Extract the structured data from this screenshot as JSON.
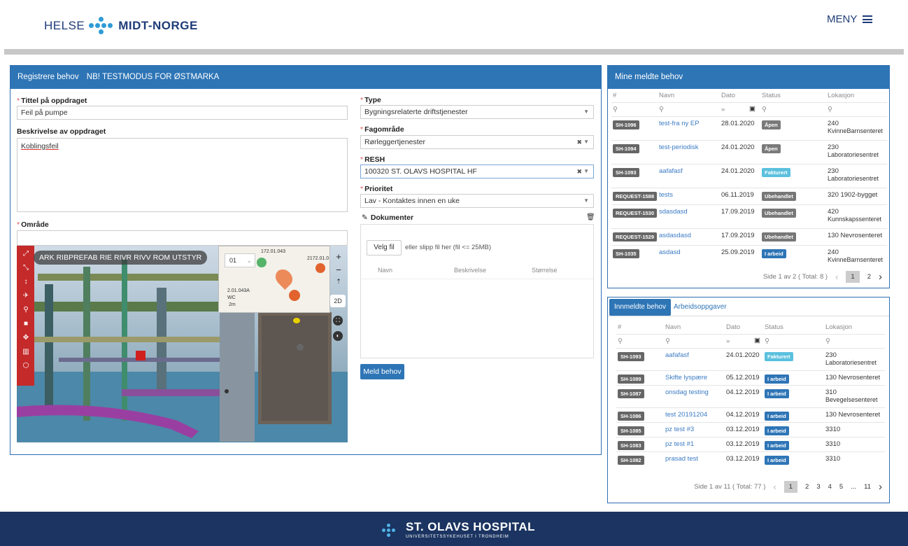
{
  "header": {
    "brand_left": "HELSE",
    "brand_right": "MIDT-NORGE",
    "menu_label": "MENY"
  },
  "form": {
    "title": "Registrere behov",
    "subtitle": "NB! TESTMODUS FOR ØSTMARKA",
    "tittel_label": "Tittel på oppdraget",
    "tittel_value": "Feil på pumpe",
    "beskrivelse_label": "Beskrivelse av oppdraget",
    "beskrivelse_value": "Koblingsfeil",
    "omrade_label": "Område",
    "type_label": "Type",
    "type_value": "Bygningsrelaterte driftstjenester",
    "fag_label": "Fagområde",
    "fag_value": "Rørleggertjenester",
    "resh_label": "RESH",
    "resh_value": "100320 ST. OLAVS HOSPITAL HF",
    "prioritet_label": "Prioritet",
    "prioritet_value": "Lav - Kontaktes innen en uke",
    "dokumenter_label": "Dokumenter",
    "velg_fil": "Velg fil",
    "drop_hint": "eller slipp fil her (fil <= 25MB)",
    "doc_cols": [
      "Navn",
      "Beskrivelse",
      "Størrelse"
    ],
    "submit": "Meld behov"
  },
  "viewer": {
    "layers": [
      "ARK",
      "RIBPREFAB",
      "RIE",
      "RIVR",
      "RIVV",
      "ROM",
      "UTSTYR"
    ],
    "floor": "01",
    "mode_2d": "2D",
    "plan_labels": [
      "172.01.043",
      "2172.01.0",
      "2.01.043A",
      "WC",
      "2m"
    ]
  },
  "mine": {
    "title": "Mine meldte behov",
    "cols": [
      "#",
      "Navn",
      "Dato",
      "Status",
      "Lokasjon"
    ],
    "rows": [
      {
        "id": "SH-1096",
        "navn": "test-fra ny EP",
        "dato": "28.01.2020",
        "status": "Åpen",
        "lok1": "240",
        "lok2": "KvinneBarnsenteret"
      },
      {
        "id": "SH-1094",
        "navn": "test-periodisk",
        "dato": "24.01.2020",
        "status": "Åpen",
        "lok1": "230",
        "lok2": "Laboratoriesentret"
      },
      {
        "id": "SH-1093",
        "navn": "aafafasf",
        "dato": "24.01.2020",
        "status": "Fakturert",
        "lok1": "230",
        "lok2": "Laboratoriesentret"
      },
      {
        "id": "REQUEST-1588",
        "navn": "tests",
        "dato": "06.11.2019",
        "status": "Ubehandlet",
        "lok1": "320 1902-bygget",
        "lok2": ""
      },
      {
        "id": "REQUEST-1530",
        "navn": "sdasdasd",
        "dato": "17.09.2019",
        "status": "Ubehandlet",
        "lok1": "420",
        "lok2": "Kunnskapssenteret"
      },
      {
        "id": "REQUEST-1529",
        "navn": "asdasdasd",
        "dato": "17.09.2019",
        "status": "Ubehandlet",
        "lok1": "130 Nevrosenteret",
        "lok2": ""
      },
      {
        "id": "SH-1035",
        "navn": "asdasd",
        "dato": "25.09.2019",
        "status": "I arbeid",
        "lok1": "240",
        "lok2": "KvinneBarnsenteret"
      }
    ],
    "pager_text": "Side 1 av 2 ( Total: 8 )",
    "pages": [
      "1",
      "2"
    ]
  },
  "innmeldte": {
    "tab_active": "Innmeldte behov",
    "tab_other": "Arbeidsoppgaver",
    "cols": [
      "#",
      "Navn",
      "Dato",
      "Status",
      "Lokasjon"
    ],
    "rows": [
      {
        "id": "SH-1093",
        "navn": "aafafasf",
        "dato": "24.01.2020",
        "status": "Fakturert",
        "lok1": "230",
        "lok2": "Laboratoriesentret"
      },
      {
        "id": "SH-1089",
        "navn": "Skifte lyspære",
        "dato": "05.12.2019",
        "status": "I arbeid",
        "lok1": "130 Nevrosenteret",
        "lok2": ""
      },
      {
        "id": "SH-1087",
        "navn": "onsdag testing",
        "dato": "04.12.2019",
        "status": "I arbeid",
        "lok1": "310",
        "lok2": "Bevegelsesenteret"
      },
      {
        "id": "SH-1086",
        "navn": "test 20191204",
        "dato": "04.12.2019",
        "status": "I arbeid",
        "lok1": "130 Nevrosenteret",
        "lok2": ""
      },
      {
        "id": "SH-1085",
        "navn": "pz test #3",
        "dato": "03.12.2019",
        "status": "I arbeid",
        "lok1": "3310",
        "lok2": ""
      },
      {
        "id": "SH-1083",
        "navn": "pz test #1",
        "dato": "03.12.2019",
        "status": "I arbeid",
        "lok1": "3310",
        "lok2": ""
      },
      {
        "id": "SH-1082",
        "navn": "prasad test",
        "dato": "03.12.2019",
        "status": "I arbeid",
        "lok1": "3310",
        "lok2": ""
      }
    ],
    "pager_text": "Side 1 av 11 ( Total: 77 )",
    "pages": [
      "1",
      "2",
      "3",
      "4",
      "5",
      "...",
      "11"
    ]
  },
  "footer": {
    "name": "ST. OLAVS HOSPITAL",
    "sub": "UNIVERSITETSSYKEHUSET I TRONDHEIM"
  },
  "colors": {
    "brand": "#2e75b6",
    "open": "#7a7a7a",
    "fakturert": "#5bc0de",
    "ubehandlet": "#777777",
    "iarbeid": "#2e75b6",
    "footer": "#1b3461"
  }
}
